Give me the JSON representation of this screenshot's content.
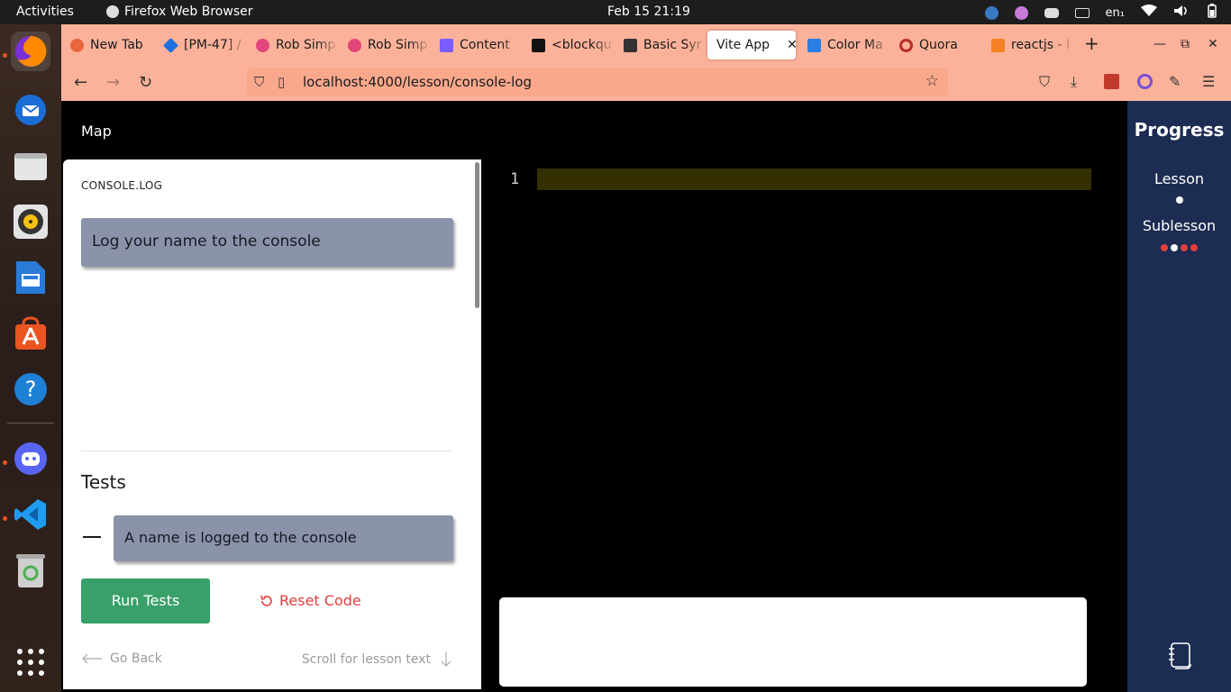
{
  "system": {
    "activities": "Activities",
    "app_name": "Firefox Web Browser",
    "clock": "Feb 15  21:19",
    "lang": "en₁"
  },
  "browser": {
    "tabs": [
      {
        "label": "New Tab",
        "color": "#e8663c"
      },
      {
        "label": "[PM-47] /",
        "color": "#1f6fe0"
      },
      {
        "label": "Rob Simp",
        "color": "#e0457b"
      },
      {
        "label": "Rob Simp",
        "color": "#e0457b"
      },
      {
        "label": "Content",
        "color": "#7a5cff"
      },
      {
        "label": "<blockqu",
        "color": "#111111"
      },
      {
        "label": "Basic Syr",
        "color": "#333333"
      },
      {
        "label": "Vite App",
        "color": "#ffffff"
      },
      {
        "label": "Color Ma",
        "color": "#2a7de1"
      },
      {
        "label": "Quora",
        "color": "#b92b27"
      },
      {
        "label": "reactjs - I",
        "color": "#f48024"
      }
    ],
    "active_tab_index": 7,
    "url": "localhost:4000/lesson/console-log"
  },
  "lesson": {
    "map_label": "Map",
    "title": "CONSOLE.LOG",
    "prompt": "Log your name to the console",
    "tests_heading": "Tests",
    "tests": [
      {
        "label": "A name is logged to the console",
        "status": "pending"
      }
    ],
    "run_tests_label": "Run Tests",
    "reset_code_label": "Reset Code",
    "go_back_label": "Go Back",
    "scroll_hint_label": "Scroll for lesson text"
  },
  "editor": {
    "line_numbers": [
      "1"
    ],
    "code": ""
  },
  "console_output": "",
  "progress": {
    "title": "Progress",
    "lesson_label": "Lesson",
    "sublesson_label": "Sublesson",
    "lesson_dots": [
      "#ffffff"
    ],
    "sublesson_dots": [
      "#e53e3e",
      "#ffffff",
      "#e53e3e",
      "#e53e3e"
    ]
  },
  "colors": {
    "tab_bar": "#fcb29a",
    "run_button": "#38a169",
    "reset_button": "#e53e3e",
    "prompt_box": "#8b93ab",
    "progress_panel": "#1c2c52",
    "active_line": "#332f00"
  }
}
